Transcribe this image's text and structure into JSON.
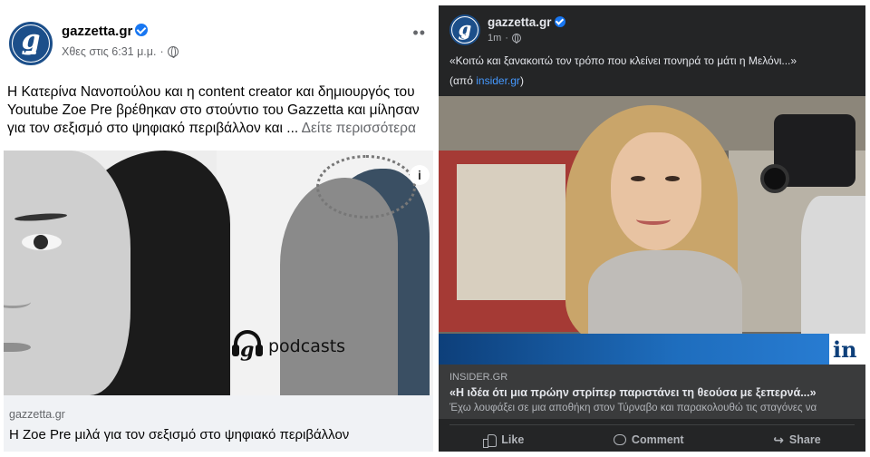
{
  "left_post": {
    "page_name": "gazzetta.gr",
    "timestamp": "Χθες στις 6:31 μ.μ.",
    "more_label": "••",
    "text_lines": [
      "Η Κατερίνα Νανοπούλου και η content creator και δημιουργός του",
      "Youtube Zoe Pre βρέθηκαν στο στούντιο του Gazzetta και μίλησαν",
      "για τον σεξισμό στο ψηφιακό περιβάλλον και ..."
    ],
    "see_more": "Δείτε περισσότερα",
    "image_info_icon": "i",
    "podcast_label": "podcasts",
    "link_domain": "gazzetta.gr",
    "link_title": "Η Zoe Pre μιλά για τον σεξισμό στο ψηφιακό περιβάλλον"
  },
  "right_post": {
    "page_name": "gazzetta.gr",
    "timestamp": "1m",
    "meta_separator": "·",
    "quote": "«Κοιτώ και ξανακοιτώ τον τρόπο που κλείνει πονηρά το μάτι η Μελόνι...»",
    "source_prefix": "(από ",
    "source_link": "insider.gr",
    "source_suffix": ")",
    "image_logo": "in",
    "link_domain": "INSIDER.GR",
    "link_title": "«Η ιδέα ότι μια πρώην στρίπερ παριστάνει τη θεούσα με ξεπερνά...»",
    "link_description": "Έχω λουφάξει σε μια αποθήκη στον Τύρναβο και παρακολουθώ τις σταγόνες να",
    "actions": {
      "like": "Like",
      "comment": "Comment",
      "share": "Share"
    }
  },
  "colors": {
    "facebook_blue": "#1877f2",
    "gazzetta_blue": "#1c4f8a",
    "dark_bg": "#242526",
    "dark_link_bg": "#3a3b3c",
    "link_blue": "#4599ff"
  },
  "icons": [
    "verified-badge-icon",
    "globe-icon",
    "more-options-icon",
    "info-icon",
    "headphones-icon",
    "like-icon",
    "comment-icon",
    "share-icon"
  ]
}
